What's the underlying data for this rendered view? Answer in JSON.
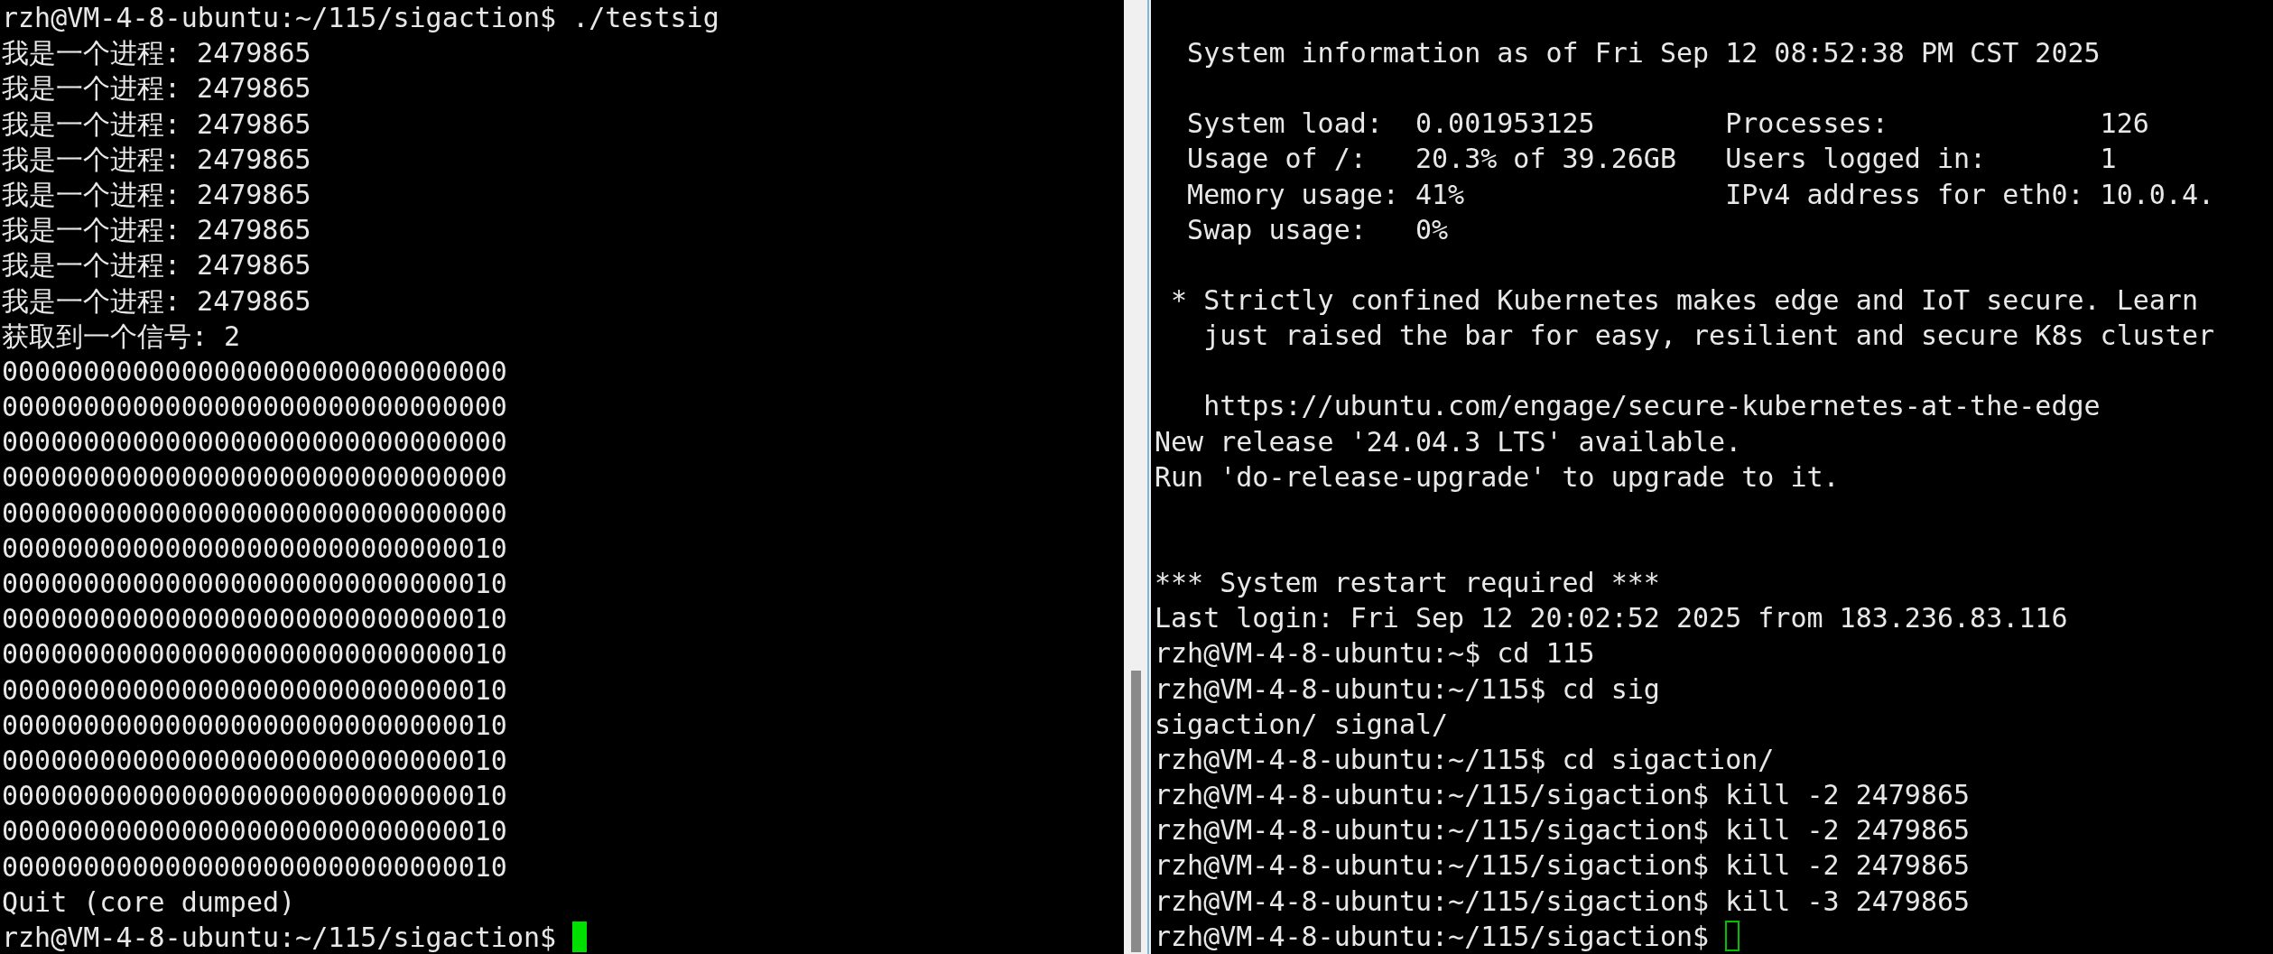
{
  "panes": [
    {
      "focused": true,
      "lines": [
        {
          "kind": "prompt",
          "prompt": "rzh@VM-4-8-ubuntu:~/115/sigaction$",
          "command": "./testsig"
        },
        {
          "kind": "output",
          "text": "我是一个进程: 2479865"
        },
        {
          "kind": "output",
          "text": "我是一个进程: 2479865"
        },
        {
          "kind": "output",
          "text": "我是一个进程: 2479865"
        },
        {
          "kind": "output",
          "text": "我是一个进程: 2479865"
        },
        {
          "kind": "output",
          "text": "我是一个进程: 2479865"
        },
        {
          "kind": "output",
          "text": "我是一个进程: 2479865"
        },
        {
          "kind": "output",
          "text": "我是一个进程: 2479865"
        },
        {
          "kind": "output",
          "text": "我是一个进程: 2479865"
        },
        {
          "kind": "output",
          "text": "获取到一个信号: 2"
        },
        {
          "kind": "output",
          "text": "0000000000000000000000000000000"
        },
        {
          "kind": "output",
          "text": "0000000000000000000000000000000"
        },
        {
          "kind": "output",
          "text": "0000000000000000000000000000000"
        },
        {
          "kind": "output",
          "text": "0000000000000000000000000000000"
        },
        {
          "kind": "output",
          "text": "0000000000000000000000000000000"
        },
        {
          "kind": "output",
          "text": "0000000000000000000000000000010"
        },
        {
          "kind": "output",
          "text": "0000000000000000000000000000010"
        },
        {
          "kind": "output",
          "text": "0000000000000000000000000000010"
        },
        {
          "kind": "output",
          "text": "0000000000000000000000000000010"
        },
        {
          "kind": "output",
          "text": "0000000000000000000000000000010"
        },
        {
          "kind": "output",
          "text": "0000000000000000000000000000010"
        },
        {
          "kind": "output",
          "text": "0000000000000000000000000000010"
        },
        {
          "kind": "output",
          "text": "0000000000000000000000000000010"
        },
        {
          "kind": "output",
          "text": "0000000000000000000000000000010"
        },
        {
          "kind": "output",
          "text": "0000000000000000000000000000010"
        },
        {
          "kind": "output",
          "text": "Quit (core dumped)"
        },
        {
          "kind": "cursor",
          "prompt": "rzh@VM-4-8-ubuntu:~/115/sigaction$"
        }
      ]
    },
    {
      "focused": false,
      "lines": [
        {
          "kind": "blank"
        },
        {
          "kind": "output",
          "text": "  System information as of Fri Sep 12 08:52:38 PM CST 2025"
        },
        {
          "kind": "blank"
        },
        {
          "kind": "output",
          "text": "  System load:  0.001953125        Processes:             126"
        },
        {
          "kind": "output",
          "text": "  Usage of /:   20.3% of 39.26GB   Users logged in:       1"
        },
        {
          "kind": "output",
          "text": "  Memory usage: 41%                IPv4 address for eth0: 10.0.4."
        },
        {
          "kind": "output",
          "text": "  Swap usage:   0%"
        },
        {
          "kind": "blank"
        },
        {
          "kind": "output",
          "text": " * Strictly confined Kubernetes makes edge and IoT secure. Learn"
        },
        {
          "kind": "output",
          "text": "   just raised the bar for easy, resilient and secure K8s cluster"
        },
        {
          "kind": "blank"
        },
        {
          "kind": "output",
          "text": "   https://ubuntu.com/engage/secure-kubernetes-at-the-edge"
        },
        {
          "kind": "output",
          "text": "New release '24.04.3 LTS' available."
        },
        {
          "kind": "output",
          "text": "Run 'do-release-upgrade' to upgrade to it."
        },
        {
          "kind": "blank"
        },
        {
          "kind": "blank"
        },
        {
          "kind": "output",
          "text": "*** System restart required ***"
        },
        {
          "kind": "output",
          "text": "Last login: Fri Sep 12 20:02:52 2025 from 183.236.83.116"
        },
        {
          "kind": "prompt",
          "prompt": "rzh@VM-4-8-ubuntu:~$",
          "command": "cd 115"
        },
        {
          "kind": "prompt",
          "prompt": "rzh@VM-4-8-ubuntu:~/115$",
          "command": "cd sig"
        },
        {
          "kind": "output",
          "text": "sigaction/ signal/"
        },
        {
          "kind": "prompt",
          "prompt": "rzh@VM-4-8-ubuntu:~/115$",
          "command": "cd sigaction/"
        },
        {
          "kind": "prompt",
          "prompt": "rzh@VM-4-8-ubuntu:~/115/sigaction$",
          "command": "kill -2 2479865"
        },
        {
          "kind": "prompt",
          "prompt": "rzh@VM-4-8-ubuntu:~/115/sigaction$",
          "command": "kill -2 2479865"
        },
        {
          "kind": "prompt",
          "prompt": "rzh@VM-4-8-ubuntu:~/115/sigaction$",
          "command": "kill -2 2479865"
        },
        {
          "kind": "prompt",
          "prompt": "rzh@VM-4-8-ubuntu:~/115/sigaction$",
          "command": "kill -3 2479865"
        },
        {
          "kind": "cursor",
          "prompt": "rzh@VM-4-8-ubuntu:~/115/sigaction$"
        }
      ]
    }
  ]
}
